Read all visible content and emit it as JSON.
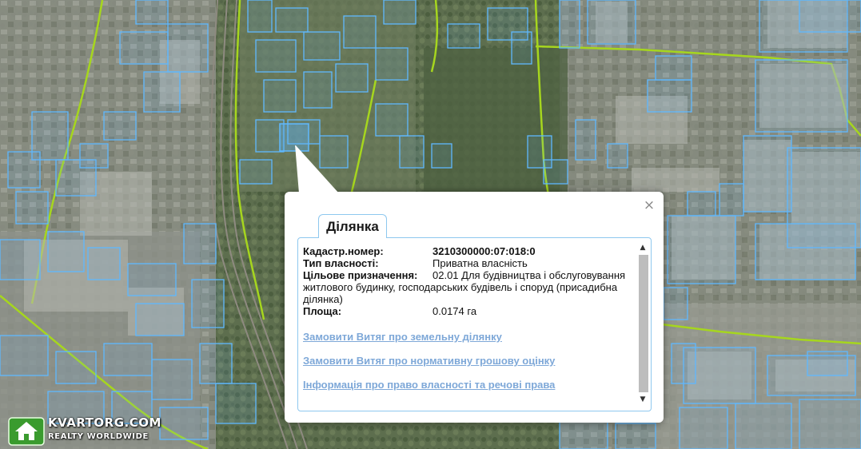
{
  "popup": {
    "tab_label": "Ділянка",
    "close_icon": "×",
    "fields": {
      "cadastral_label": "Кадастр.номер:",
      "cadastral_value": "3210300000:07:018:0",
      "ownership_label": "Тип власності:",
      "ownership_value": "Приватна власність",
      "purpose_label": "Цільове призначення:",
      "purpose_value": "02.01 Для будівництва і обслуговування житлового будинку, господарських будівель і споруд (присадибна ділянка)",
      "area_label": "Площа:",
      "area_value": "0.0174 га"
    },
    "links": [
      "Замовити Витяг про земельну ділянку",
      "Замовити Витяг про нормативну грошову оцінку",
      "Інформація про право власності та речові права"
    ],
    "scroll_up_icon": "▲",
    "scroll_down_icon": "▼"
  },
  "watermark": {
    "brand": "KVARTORG.COM",
    "tagline": "REALTY WORLDWIDE"
  },
  "colors": {
    "parcel_outline": "#5fb8ff",
    "boundary_line": "#a6d61e",
    "link": "#7ea8d8",
    "tab_border": "#8ec8ef"
  }
}
